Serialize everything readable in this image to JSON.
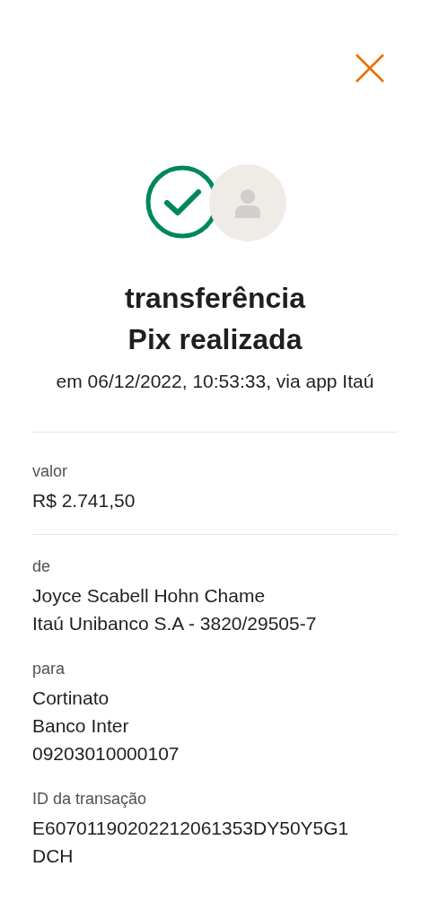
{
  "title_lines": [
    "transferência",
    "Pix realizada"
  ],
  "subtitle": "em 06/12/2022, 10:53:33, via app Itaú",
  "amount": {
    "label": "valor",
    "value": "R$ 2.741,50"
  },
  "details": [
    {
      "label": "de",
      "lines": [
        "Joyce Scabell Hohn Chame",
        "Itaú Unibanco S.A - 3820/29505-7"
      ]
    },
    {
      "label": "para",
      "lines": [
        "Cortinato",
        "Banco Inter",
        "09203010000107"
      ]
    },
    {
      "label": "ID da transação",
      "lines": [
        "E60701190202212061353DY50Y5G1",
        "DCH"
      ]
    }
  ]
}
